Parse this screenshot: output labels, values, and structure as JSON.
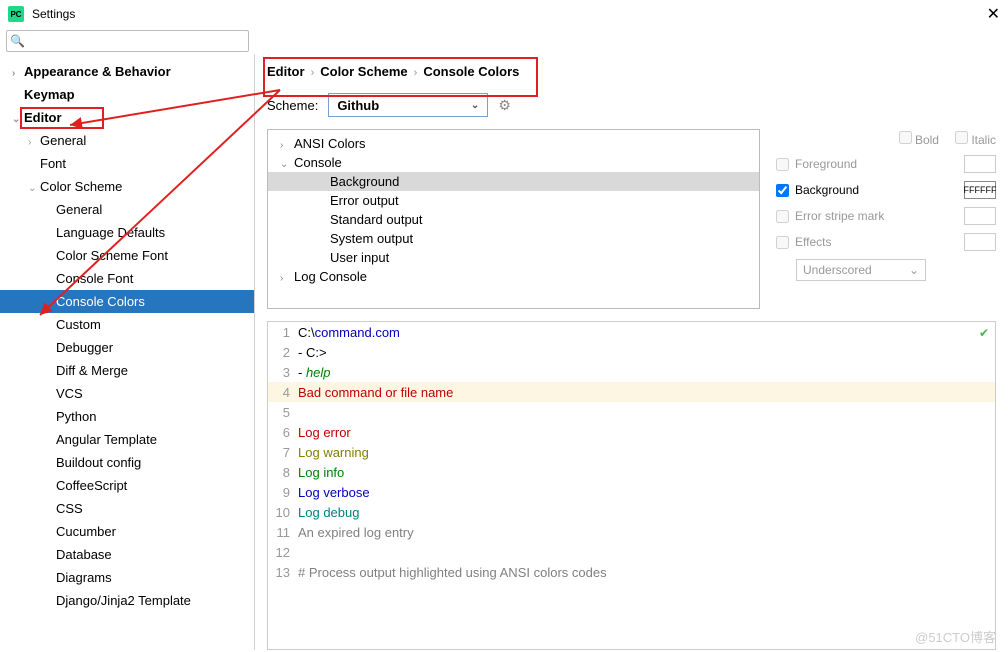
{
  "window": {
    "title": "Settings"
  },
  "search": {
    "placeholder": ""
  },
  "sidebar": {
    "items": [
      {
        "label": "Appearance & Behavior",
        "bold": true,
        "arrow": "›",
        "indent": 0
      },
      {
        "label": "Keymap",
        "bold": true,
        "indent": 0
      },
      {
        "label": "Editor",
        "bold": true,
        "arrow": "⌄",
        "indent": 0,
        "highlight": true
      },
      {
        "label": "General",
        "arrow": "›",
        "indent": 1
      },
      {
        "label": "Font",
        "indent": 1
      },
      {
        "label": "Color Scheme",
        "arrow": "⌄",
        "indent": 1
      },
      {
        "label": "General",
        "indent": 2
      },
      {
        "label": "Language Defaults",
        "indent": 2
      },
      {
        "label": "Color Scheme Font",
        "indent": 2
      },
      {
        "label": "Console Font",
        "indent": 2
      },
      {
        "label": "Console Colors",
        "indent": 2,
        "selected": true
      },
      {
        "label": "Custom",
        "indent": 2
      },
      {
        "label": "Debugger",
        "indent": 2
      },
      {
        "label": "Diff & Merge",
        "indent": 2
      },
      {
        "label": "VCS",
        "indent": 2
      },
      {
        "label": "Python",
        "indent": 2
      },
      {
        "label": "Angular Template",
        "indent": 2
      },
      {
        "label": "Buildout config",
        "indent": 2
      },
      {
        "label": "CoffeeScript",
        "indent": 2
      },
      {
        "label": "CSS",
        "indent": 2
      },
      {
        "label": "Cucumber",
        "indent": 2
      },
      {
        "label": "Database",
        "indent": 2
      },
      {
        "label": "Diagrams",
        "indent": 2
      },
      {
        "label": "Django/Jinja2 Template",
        "indent": 2
      }
    ]
  },
  "breadcrumb": {
    "p1": "Editor",
    "p2": "Color Scheme",
    "p3": "Console Colors",
    "sep": "›"
  },
  "scheme": {
    "label": "Scheme:",
    "value": "Github"
  },
  "categories": [
    {
      "label": "ANSI Colors",
      "arrow": "›",
      "indent": 0
    },
    {
      "label": "Console",
      "arrow": "⌄",
      "indent": 0
    },
    {
      "label": "Background",
      "indent": 1,
      "selected": true
    },
    {
      "label": "Error output",
      "indent": 1
    },
    {
      "label": "Standard output",
      "indent": 1
    },
    {
      "label": "System output",
      "indent": 1
    },
    {
      "label": "User input",
      "indent": 1
    },
    {
      "label": "Log Console",
      "arrow": "›",
      "indent": 0
    }
  ],
  "props": {
    "bold": "Bold",
    "italic": "Italic",
    "foreground": "Foreground",
    "background": "Background",
    "bg_value": "FFFFFF",
    "error_stripe": "Error stripe mark",
    "effects": "Effects",
    "effects_value": "Underscored"
  },
  "preview": [
    {
      "n": 1,
      "parts": [
        {
          "t": "C:\\",
          "c": "c-black"
        },
        {
          "t": "command.com",
          "c": "c-blue"
        }
      ]
    },
    {
      "n": 2,
      "parts": [
        {
          "t": "- C:>",
          "c": "c-black"
        }
      ]
    },
    {
      "n": 3,
      "parts": [
        {
          "t": "- ",
          "c": "c-black"
        },
        {
          "t": "help",
          "c": "c-green-i"
        }
      ]
    },
    {
      "n": 4,
      "hl": true,
      "parts": [
        {
          "t": "Bad command or file name",
          "c": "c-red"
        }
      ]
    },
    {
      "n": 5,
      "parts": []
    },
    {
      "n": 6,
      "parts": [
        {
          "t": "Log ",
          "c": "c-red"
        },
        {
          "t": "error",
          "c": "c-red"
        }
      ]
    },
    {
      "n": 7,
      "parts": [
        {
          "t": "Log ",
          "c": "c-olive"
        },
        {
          "t": "warning",
          "c": "c-olive"
        }
      ]
    },
    {
      "n": 8,
      "parts": [
        {
          "t": "Log ",
          "c": "c-green"
        },
        {
          "t": "info",
          "c": "c-green"
        }
      ]
    },
    {
      "n": 9,
      "parts": [
        {
          "t": "Log ",
          "c": "c-nav"
        },
        {
          "t": "verbose",
          "c": "c-nav"
        }
      ]
    },
    {
      "n": 10,
      "parts": [
        {
          "t": "Log ",
          "c": "c-cyan"
        },
        {
          "t": "debug",
          "c": "c-cyan"
        }
      ]
    },
    {
      "n": 11,
      "parts": [
        {
          "t": "An expired log entry",
          "c": "c-gray"
        }
      ]
    },
    {
      "n": 12,
      "parts": []
    },
    {
      "n": 13,
      "parts": [
        {
          "t": "# Process output highlighted using ANSI colors codes",
          "c": "c-gray"
        }
      ]
    }
  ],
  "watermark": "@51CTO博客"
}
